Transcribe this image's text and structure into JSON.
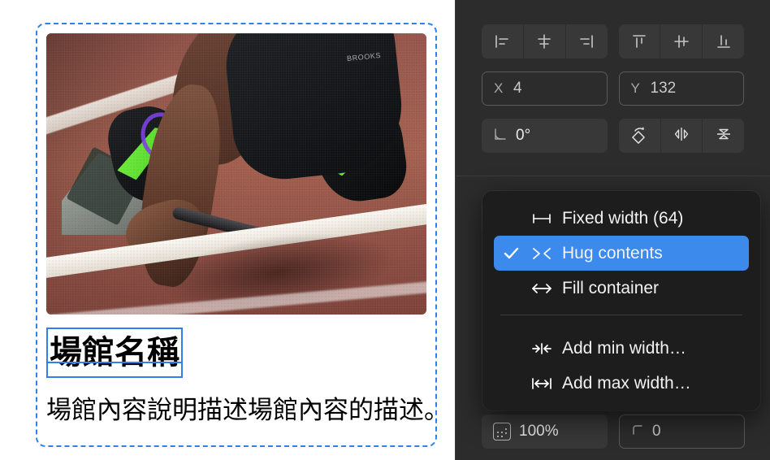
{
  "app": {
    "name": "design-editor"
  },
  "canvas": {
    "card": {
      "heading": "場館名稱",
      "description": "場館內容說明描述場館內容的描述。",
      "photo_alt": "sprinter-at-starting-blocks",
      "photo_brand_text": "BROOKS",
      "selection_color": "#2f80ed"
    }
  },
  "panel": {
    "align_horizontal": [
      {
        "name": "align-left",
        "label": "Align left"
      },
      {
        "name": "align-horizontal-center",
        "label": "Align horizontal centers"
      },
      {
        "name": "align-right",
        "label": "Align right"
      }
    ],
    "align_vertical": [
      {
        "name": "align-top",
        "label": "Align top"
      },
      {
        "name": "align-vertical-center",
        "label": "Align vertical centers"
      },
      {
        "name": "align-bottom",
        "label": "Align bottom"
      }
    ],
    "position": {
      "x_label": "X",
      "x_value": "4",
      "y_label": "Y",
      "y_value": "132"
    },
    "rotation": {
      "icon": "angle-icon",
      "value": "0°"
    },
    "transform": [
      {
        "name": "rotate",
        "label": "Rotate 90°"
      },
      {
        "name": "flip-horizontal",
        "label": "Flip horizontal"
      },
      {
        "name": "flip-vertical",
        "label": "Flip vertical"
      }
    ],
    "appearance": {
      "opacity_value": "100%",
      "corner_radius_value": "0"
    }
  },
  "menu": {
    "items": [
      {
        "icon": "↔",
        "icon_name": "fixed-width-icon",
        "label": "Fixed width (64)",
        "selected": false
      },
      {
        "icon": "›‹",
        "icon_name": "hug-contents-icon",
        "label": "Hug contents",
        "selected": true
      },
      {
        "icon": "↔",
        "icon_name": "fill-container-icon",
        "label": "Fill container",
        "selected": false
      },
      {
        "icon": "→|←",
        "icon_name": "add-min-width-icon",
        "label": "Add min width…",
        "selected": false
      },
      {
        "icon": "|↔|",
        "icon_name": "add-max-width-icon",
        "label": "Add max width…",
        "selected": false
      }
    ],
    "highlight_color": "#3b8aec",
    "check_glyph": "✔"
  }
}
